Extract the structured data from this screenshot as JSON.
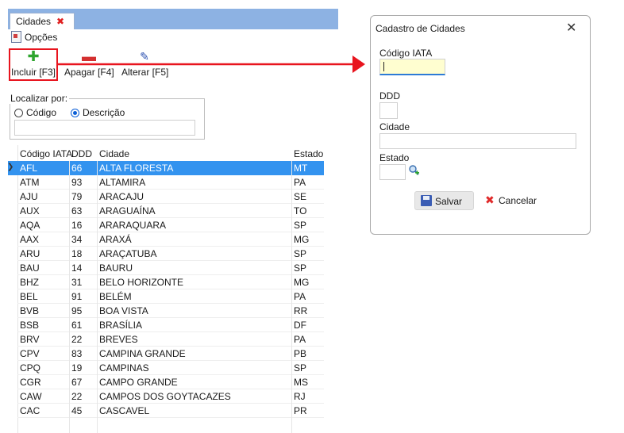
{
  "form": {
    "tab_title": "Cidades",
    "tab_close": "✖",
    "menu_label": "Opções",
    "toolbar": {
      "incluir": "Incluir [F3]",
      "apagar": "Apagar [F4]",
      "alterar": "Alterar [F5]"
    },
    "search": {
      "legend": "Localizar por:",
      "option_codigo": "Código",
      "option_descricao": "Descrição",
      "selected": "Descrição",
      "value": ""
    },
    "grid": {
      "columns": [
        "Código IATA",
        "DDD",
        "Cidade",
        "Estado"
      ],
      "rows": [
        [
          "AFL",
          "66",
          "ALTA FLORESTA",
          "MT"
        ],
        [
          "ATM",
          "93",
          "ALTAMIRA",
          "PA"
        ],
        [
          "AJU",
          "79",
          "ARACAJU",
          "SE"
        ],
        [
          "AUX",
          "63",
          "ARAGUAÍNA",
          "TO"
        ],
        [
          "AQA",
          "16",
          "ARARAQUARA",
          "SP"
        ],
        [
          "AAX",
          "34",
          "ARAXÁ",
          "MG"
        ],
        [
          "ARU",
          "18",
          "ARAÇATUBA",
          "SP"
        ],
        [
          "BAU",
          "14",
          "BAURU",
          "SP"
        ],
        [
          "BHZ",
          "31",
          "BELO HORIZONTE",
          "MG"
        ],
        [
          "BEL",
          "91",
          "BELÉM",
          "PA"
        ],
        [
          "BVB",
          "95",
          "BOA VISTA",
          "RR"
        ],
        [
          "BSB",
          "61",
          "BRASÍLIA",
          "DF"
        ],
        [
          "BRV",
          "22",
          "BREVES",
          "PA"
        ],
        [
          "CPV",
          "83",
          "CAMPINA GRANDE",
          "PB"
        ],
        [
          "CPQ",
          "19",
          "CAMPINAS",
          "SP"
        ],
        [
          "CGR",
          "67",
          "CAMPO GRANDE",
          "MS"
        ],
        [
          "CAW",
          "22",
          "CAMPOS DOS GOYTACAZES",
          "RJ"
        ],
        [
          "CAC",
          "45",
          "CASCAVEL",
          "PR"
        ]
      ],
      "selected_row": 0
    }
  },
  "dialog": {
    "title": "Cadastro de Cidades",
    "close": "✕",
    "labels": {
      "iata": "Código IATA",
      "ddd": "DDD",
      "cidade": "Cidade",
      "estado": "Estado"
    },
    "values": {
      "iata": "",
      "ddd": "",
      "cidade": "",
      "estado": ""
    },
    "save_label": "Salvar",
    "cancel_label": "Cancelar"
  },
  "colors": {
    "highlight": "#e8141e",
    "selection": "#3393ef",
    "tab_strip": "#8db2e3",
    "focused_field": "#fffed0"
  }
}
